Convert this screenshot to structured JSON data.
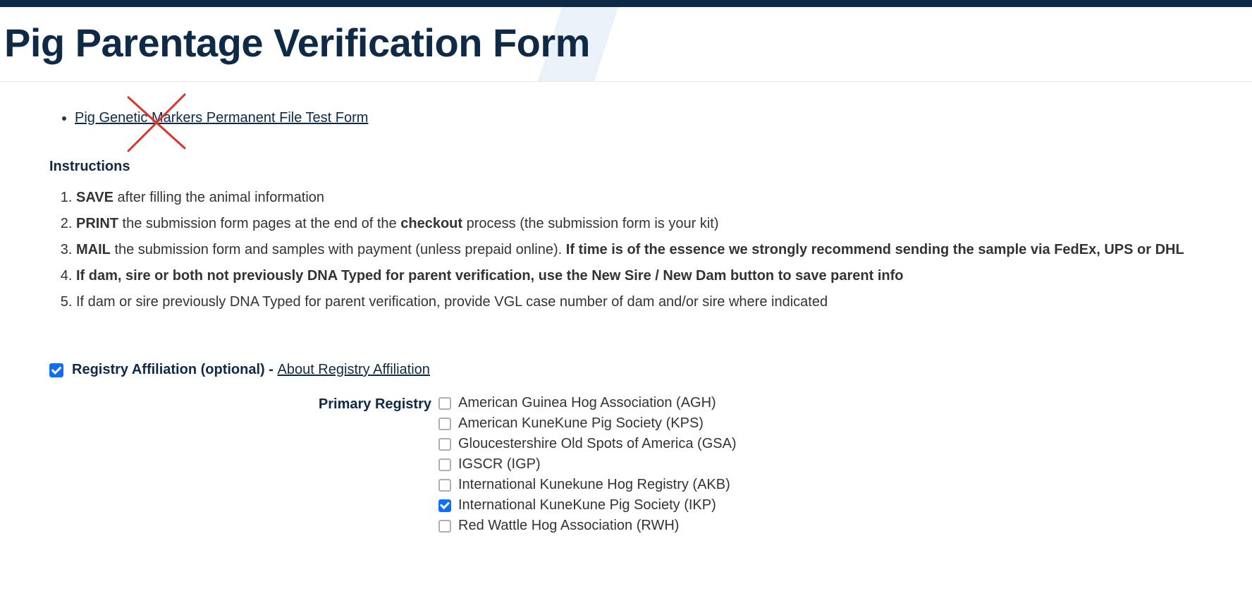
{
  "page": {
    "title": "Pig Parentage Verification Form"
  },
  "links": {
    "genetic_markers": "Pig Genetic Markers Permanent File Test Form",
    "about_registry": "About Registry Affiliation"
  },
  "instructions": {
    "heading": "Instructions",
    "item1_bold": "SAVE",
    "item1_rest": " after filling the animal information",
    "item2_bold": "PRINT",
    "item2_mid": " the submission form pages at the end of the ",
    "item2_bold2": "checkout",
    "item2_rest": " process (the submission form is your kit)",
    "item3_bold": "MAIL",
    "item3_mid": " the submission form and samples with payment (unless prepaid online). ",
    "item3_bold2": "If time is of the essence we strongly recommend sending the sample via FedEx, UPS or DHL",
    "item4_bold": "If dam, sire or both not previously DNA Typed for parent verification, use the New Sire / New Dam button to save parent info",
    "item5": "If dam or sire previously DNA Typed for parent verification, provide VGL case number of dam and/or sire where indicated"
  },
  "registry": {
    "toggle_checked": true,
    "label": "Registry Affiliation (optional)",
    "dash": " - ",
    "primary_label": "Primary Registry",
    "options": [
      {
        "label": "American Guinea Hog Association (AGH)",
        "checked": false
      },
      {
        "label": "American KuneKune Pig Society (KPS)",
        "checked": false
      },
      {
        "label": "Gloucestershire Old Spots of America (GSA)",
        "checked": false
      },
      {
        "label": "IGSCR (IGP)",
        "checked": false
      },
      {
        "label": "International Kunekune Hog Registry (AKB)",
        "checked": false
      },
      {
        "label": "International KuneKune Pig Society (IKP)",
        "checked": true
      },
      {
        "label": "Red Wattle Hog Association (RWH)",
        "checked": false
      }
    ]
  },
  "annotation": {
    "red_x_stroke": "#d9362f"
  }
}
